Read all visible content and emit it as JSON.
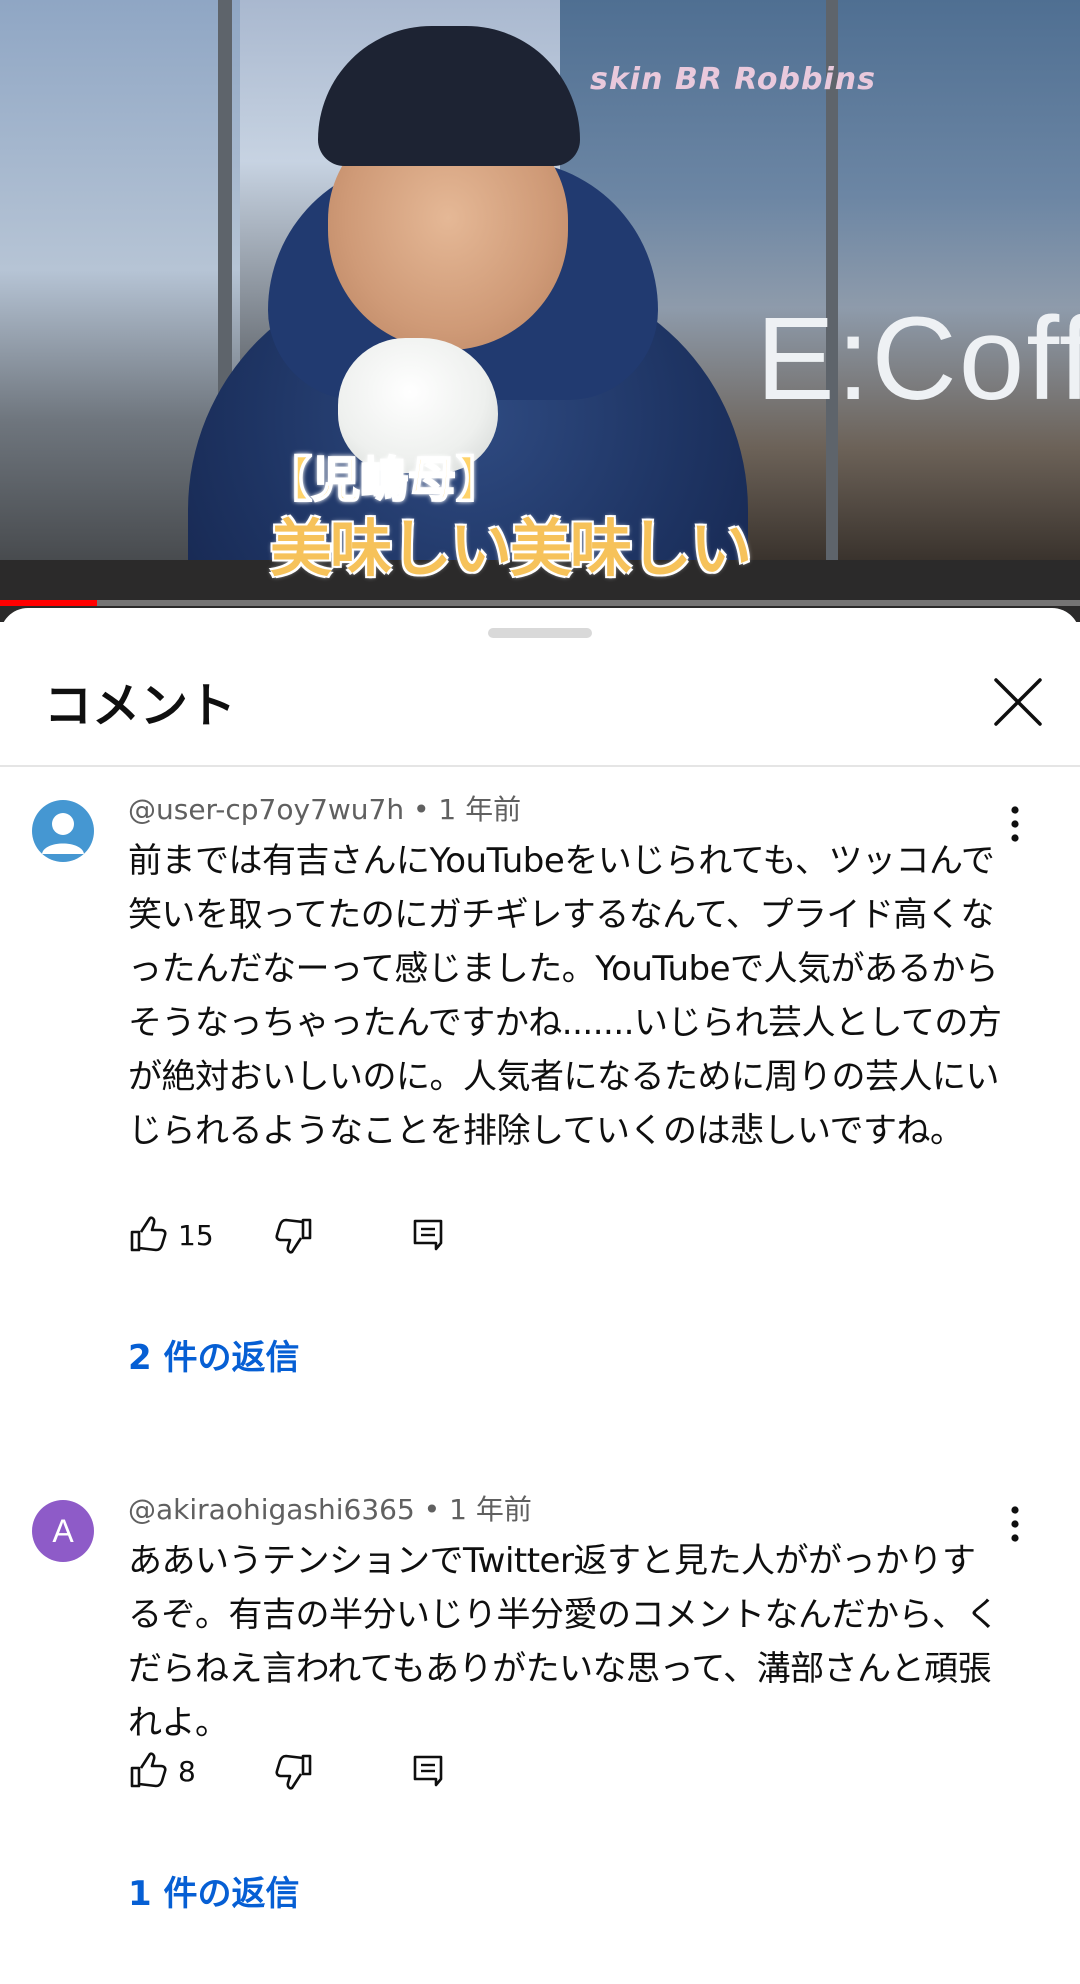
{
  "video": {
    "store_sign": "skin BR Robbins",
    "store_sign_br": "BR",
    "coffee_sign": "E:Coff",
    "caption_speaker": "【児嶋母】",
    "caption_text": "美味しい美味しい",
    "progress_fraction": 0.09
  },
  "sheet": {
    "title": "コメント",
    "close_icon": "close-icon"
  },
  "comments": [
    {
      "author": "@user-cp7oy7wu7h",
      "time": "1 年前",
      "text": "前までは有吉さんにYouTubeをいじられても、ツッコんで笑いを取ってたのにガチギレするなんて、プライド高くなったんだなーって感じました。YouTubeで人気があるからそうなっちゃったんですかね.......いじられ芸人としての方が絶対おいしいのに。人気者になるために周りの芸人にいじられるようなことを排除していくのは悲しいですね。",
      "likes": "15",
      "replies": "2 件の返信",
      "avatar": "default-avatar-icon",
      "avatar_color": "#4597d2"
    },
    {
      "author": "@akiraohigashi6365",
      "time": "1 年前",
      "text": "ああいうテンションでTwitter返すと見た人ががっかりするぞ。有吉の半分いじり半分愛のコメントなんだから、くだらねえ言われてもありがたいな思って、溝部さんと頑張れよ。",
      "likes": "8",
      "replies": "1 件の返信",
      "avatar_letter": "A",
      "avatar_color": "#8e5bc8"
    }
  ],
  "colors": {
    "link": "#065fd4",
    "meta": "#606060",
    "progress": "#ff0000"
  }
}
